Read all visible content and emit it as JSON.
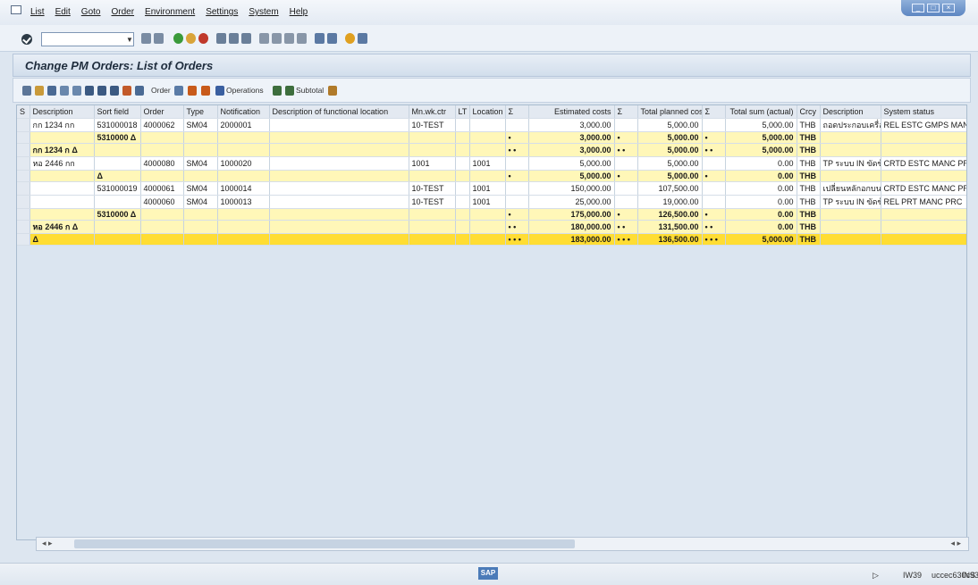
{
  "menu": [
    "List",
    "Edit",
    "Goto",
    "Order",
    "Environment",
    "Settings",
    "System",
    "Help"
  ],
  "window": {
    "title": "Change PM Orders: List of Orders"
  },
  "toolbar": {
    "order_label": "Order",
    "operations_label": "Operations",
    "subtotal_label": "Subtotal"
  },
  "columns": [
    "S",
    "Description",
    "Sort field",
    "Order",
    "Type",
    "Notification",
    "Description of functional location",
    "Mn.wk.ctr",
    "LT",
    "Location",
    "Σ",
    "Estimated costs",
    "Σ",
    "Total planned costs",
    "Σ",
    "Total sum (actual)",
    "Crcy",
    "Description",
    "System status"
  ],
  "rows": [
    {
      "kind": "data",
      "cells": [
        "",
        "กก 1234 กก",
        "531000018",
        "4000062",
        "SM04",
        "2000001",
        "",
        "10-TEST",
        "",
        "",
        "",
        "3,000.00",
        "",
        "5,000.00",
        "",
        "5,000.00",
        "THB",
        "ถอดประกอบเครื่องยนต์",
        "REL  ESTC GMPS MANC PRC"
      ]
    },
    {
      "kind": "sub",
      "cells": [
        "",
        "",
        "5310000 Δ",
        "",
        "",
        "",
        "",
        "",
        "",
        "",
        "•",
        "3,000.00",
        "•",
        "5,000.00",
        "•",
        "5,000.00",
        "THB",
        "",
        ""
      ]
    },
    {
      "kind": "sub",
      "cells": [
        "",
        "กก 1234 ก Δ",
        "",
        "",
        "",
        "",
        "",
        "",
        "",
        "",
        "• •",
        "3,000.00",
        "• •",
        "5,000.00",
        "• •",
        "5,000.00",
        "THB",
        "",
        ""
      ]
    },
    {
      "kind": "data",
      "cells": [
        "",
        "หอ 2446 กก",
        "",
        "4000080",
        "SM04",
        "1000020",
        "",
        "1001",
        "",
        "1001",
        "",
        "5,000.00",
        "",
        "5,000.00",
        "",
        "0.00",
        "THB",
        "TP ระบบ IN ขัดข้อง",
        "CRTD ESTC MANC PRC"
      ]
    },
    {
      "kind": "sub",
      "cells": [
        "",
        "",
        "Δ",
        "",
        "",
        "",
        "",
        "",
        "",
        "",
        "•",
        "5,000.00",
        "•",
        "5,000.00",
        "•",
        "0.00",
        "THB",
        "",
        ""
      ]
    },
    {
      "kind": "data",
      "cells": [
        "",
        "",
        "531000019",
        "4000061",
        "SM04",
        "1000014",
        "",
        "10-TEST",
        "",
        "1001",
        "",
        "150,000.00",
        "",
        "107,500.00",
        "",
        "0.00",
        "THB",
        "เปลี่ยนหลักอกบน",
        "CRTD ESTC MANC PRC"
      ]
    },
    {
      "kind": "data",
      "cells": [
        "",
        "",
        "",
        "4000060",
        "SM04",
        "1000013",
        "",
        "10-TEST",
        "",
        "1001",
        "",
        "25,000.00",
        "",
        "19,000.00",
        "",
        "0.00",
        "THB",
        "TP ระบบ IN ขัดข้อง",
        "REL  PRT  MANC PRC"
      ]
    },
    {
      "kind": "sub",
      "cells": [
        "",
        "",
        "5310000 Δ",
        "",
        "",
        "",
        "",
        "",
        "",
        "",
        "•",
        "175,000.00",
        "•",
        "126,500.00",
        "•",
        "0.00",
        "THB",
        "",
        ""
      ]
    },
    {
      "kind": "sub",
      "cells": [
        "",
        "หอ 2446 ก Δ",
        "",
        "",
        "",
        "",
        "",
        "",
        "",
        "",
        "• •",
        "180,000.00",
        "• •",
        "131,500.00",
        "• •",
        "0.00",
        "THB",
        "",
        ""
      ]
    },
    {
      "kind": "tot",
      "cells": [
        "",
        "Δ",
        "",
        "",
        "",
        "",
        "",
        "",
        "",
        "",
        "• • •",
        "183,000.00",
        "• • •",
        "136,500.00",
        "• • •",
        "5,000.00",
        "THB",
        "",
        ""
      ]
    }
  ],
  "status": {
    "logo": "SAP",
    "transaction": "IW39",
    "server": "uccec630c93",
    "mode": "INS"
  }
}
